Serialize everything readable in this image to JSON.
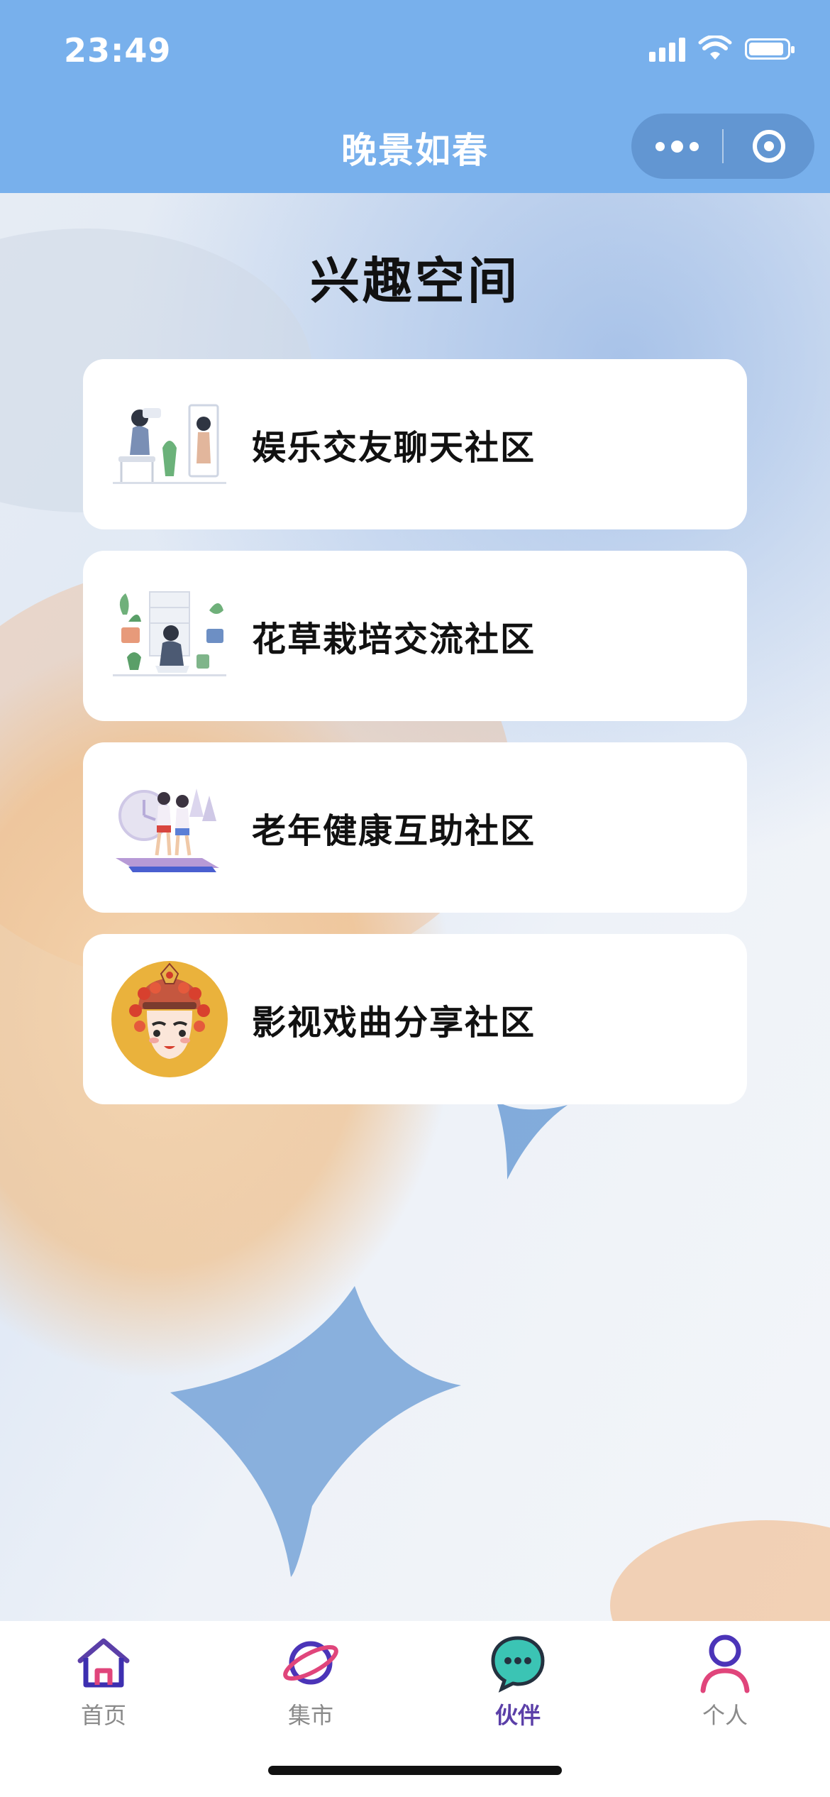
{
  "status_bar": {
    "time": "23:49"
  },
  "nav": {
    "title": "晚景如春",
    "more_icon": "more-dots-icon",
    "close_icon": "target-close-icon"
  },
  "main": {
    "title": "兴趣空间",
    "communities": [
      {
        "label": "娱乐交友聊天社区",
        "icon": "social-chat-illustration"
      },
      {
        "label": "花草栽培交流社区",
        "icon": "gardening-illustration"
      },
      {
        "label": "老年健康互助社区",
        "icon": "fitness-illustration"
      },
      {
        "label": "影视戏曲分享社区",
        "icon": "opera-mask-illustration"
      }
    ]
  },
  "tabbar": {
    "active_index": 2,
    "active_color": "#5b3fa8",
    "tabs": [
      {
        "label": "首页",
        "icon": "home-icon"
      },
      {
        "label": "集市",
        "icon": "planet-icon"
      },
      {
        "label": "伙伴",
        "icon": "chat-bubble-icon"
      },
      {
        "label": "个人",
        "icon": "person-icon"
      }
    ]
  },
  "colors": {
    "header": "#78b0ec",
    "card": "#ffffff",
    "accent_orange": "#f0b878",
    "accent_blue": "#6f9fd6"
  }
}
